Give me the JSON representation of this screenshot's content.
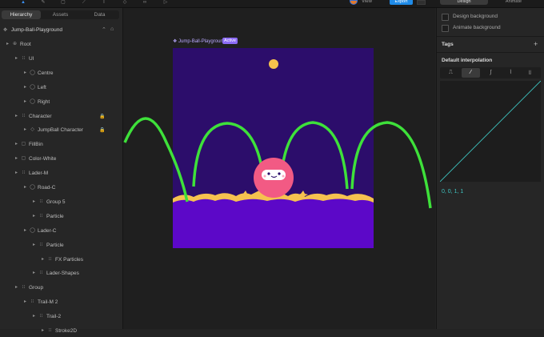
{
  "toolbar": {
    "icons": [
      "pointer-icon",
      "pen-icon",
      "shape-icon",
      "bone-icon",
      "text-icon",
      "node-icon",
      "link-icon",
      "play-icon"
    ],
    "view_label": "View",
    "export_label": "Export",
    "right_tabs": [
      "Design",
      "Animate"
    ],
    "active_right_tab": "Design"
  },
  "left_panel": {
    "tabs": [
      "Hierarchy",
      "Assets",
      "Data"
    ],
    "active_tab": "Hierarchy",
    "project_name": "Jump-Ball-Playground",
    "tree": [
      {
        "label": "Root",
        "depth": 0,
        "icon": "artboard-icon"
      },
      {
        "label": "UI",
        "depth": 1,
        "icon": "group-icon"
      },
      {
        "label": "Centre",
        "depth": 2,
        "icon": "ellipse-icon"
      },
      {
        "label": "Left",
        "depth": 2,
        "icon": "ellipse-icon"
      },
      {
        "label": "Right",
        "depth": 2,
        "icon": "ellipse-icon"
      },
      {
        "label": "Character",
        "depth": 1,
        "icon": "group-icon",
        "lock": true
      },
      {
        "label": "JumpBall Character",
        "depth": 2,
        "icon": "component-icon",
        "lock": true
      },
      {
        "label": "FillBin",
        "depth": 1,
        "icon": "shape-icon"
      },
      {
        "label": "Color-White",
        "depth": 1,
        "icon": "shape-icon"
      },
      {
        "label": "Lader-M",
        "depth": 1,
        "icon": "group-icon"
      },
      {
        "label": "Road-C",
        "depth": 2,
        "icon": "ellipse-icon"
      },
      {
        "label": "Group 5",
        "depth": 3,
        "icon": "group-icon"
      },
      {
        "label": "Particle",
        "depth": 3,
        "icon": "group-icon"
      },
      {
        "label": "Lader-C",
        "depth": 2,
        "icon": "ellipse-icon"
      },
      {
        "label": "Particle",
        "depth": 3,
        "icon": "group-icon"
      },
      {
        "label": "FX Particles",
        "depth": 4,
        "icon": "group-icon"
      },
      {
        "label": "Lader-Shapes",
        "depth": 3,
        "icon": "group-icon"
      },
      {
        "label": "Group",
        "depth": 1,
        "icon": "group-icon"
      },
      {
        "label": "Trail-M 2",
        "depth": 2,
        "icon": "group-icon"
      },
      {
        "label": "Trail-2",
        "depth": 3,
        "icon": "group-icon"
      },
      {
        "label": "Stroke2D",
        "depth": 4,
        "icon": "group-icon"
      }
    ]
  },
  "canvas": {
    "artboard_name": "Jump-Ball-Playground",
    "artboard_badge": "Active",
    "colors": {
      "sky": "#2c0d6b",
      "ground": "#5c08c8",
      "arc": "#3ee13a",
      "sun": "#f5c24c",
      "ball": "#f25a84",
      "wave": "#f6c24f"
    }
  },
  "right_panel": {
    "checkboxes": [
      "Design background",
      "Animate background"
    ],
    "tags_title": "Tags",
    "interpolation_title": "Default interpolation",
    "interpolation_options": [
      "hold-icon",
      "linear-icon",
      "cubic-icon",
      "elastic-icon",
      "bounce-icon"
    ],
    "active_interpolation": "linear-icon",
    "interpolation_values": "0, 0, 1, 1",
    "accent": "#3ec5c2"
  }
}
